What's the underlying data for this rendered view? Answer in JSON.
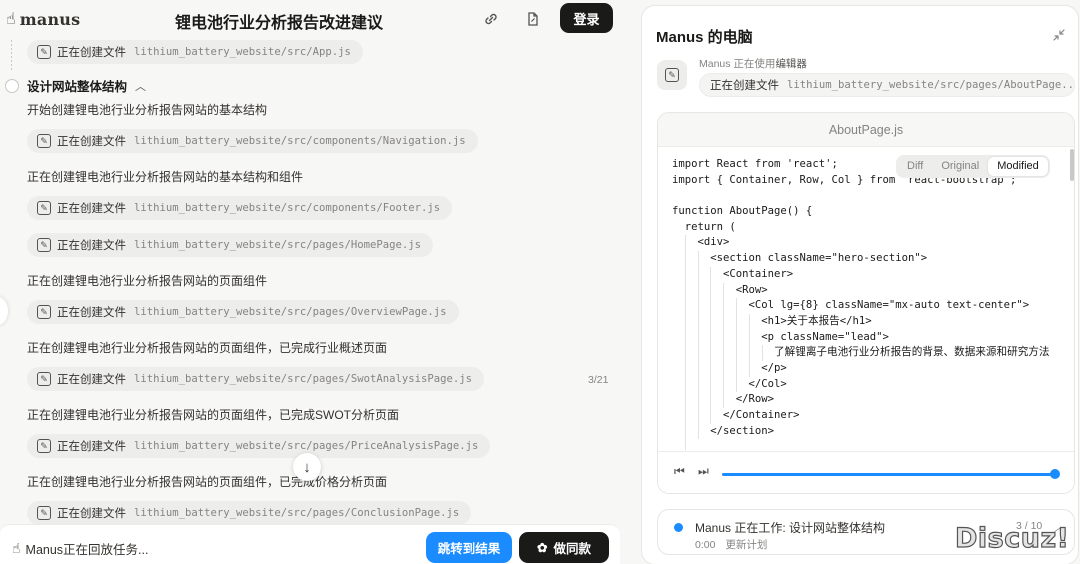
{
  "app": {
    "logo_text": "manus",
    "title": "锂电池行业分析报告改进建议",
    "login_label": "登录"
  },
  "feed": {
    "first_chip": {
      "verb": "正在创建文件",
      "path": "lithium_battery_website/src/App.js"
    },
    "section": {
      "label": "设计网站整体结构",
      "chevron": "^"
    },
    "items": [
      {
        "kind": "text",
        "text": "开始创建锂电池行业分析报告网站的基本结构"
      },
      {
        "kind": "chip",
        "verb": "正在创建文件",
        "path": "lithium_battery_website/src/components/Navigation.js"
      },
      {
        "kind": "text",
        "text": "正在创建锂电池行业分析报告网站的基本结构和组件"
      },
      {
        "kind": "chip",
        "verb": "正在创建文件",
        "path": "lithium_battery_website/src/components/Footer.js"
      },
      {
        "kind": "chip",
        "verb": "正在创建文件",
        "path": "lithium_battery_website/src/pages/HomePage.js"
      },
      {
        "kind": "text",
        "text": "正在创建锂电池行业分析报告网站的页面组件"
      },
      {
        "kind": "chip",
        "verb": "正在创建文件",
        "path": "lithium_battery_website/src/pages/OverviewPage.js"
      },
      {
        "kind": "text",
        "text": "正在创建锂电池行业分析报告网站的页面组件，已完成行业概述页面"
      },
      {
        "kind": "chip",
        "verb": "正在创建文件",
        "path": "lithium_battery_website/src/pages/SwotAnalysisPage.js"
      },
      {
        "kind": "text",
        "text": "正在创建锂电池行业分析报告网站的页面组件，已完成SWOT分析页面"
      },
      {
        "kind": "chip",
        "verb": "正在创建文件",
        "path": "lithium_battery_website/src/pages/PriceAnalysisPage.js"
      },
      {
        "kind": "text",
        "text": "正在创建锂电池行业分析报告网站的页面组件，已完成价格分析页面"
      },
      {
        "kind": "chip",
        "verb": "正在创建文件",
        "path": "lithium_battery_website/src/pages/ConclusionPage.js"
      }
    ],
    "counter": "3/21"
  },
  "bottom": {
    "replay_text": "Manus正在回放任务...",
    "jump_label": "跳转到结果",
    "same_label": "做同款"
  },
  "computer": {
    "title": "Manus 的电脑",
    "using_prefix": "Manus 正在使用",
    "using_tool": "编辑器",
    "chip": {
      "verb": "正在创建文件",
      "path": "lithium_battery_website/src/pages/AboutPage..."
    },
    "editor": {
      "filename": "AboutPage.js",
      "view_tabs": [
        "Diff",
        "Original",
        "Modified"
      ],
      "active_tab": "Modified",
      "code_lines": [
        "import React from 'react';",
        "import { Container, Row, Col } from 'react-bootstrap';",
        "",
        "function AboutPage() {",
        "  return (",
        "    <div>",
        "      <section className=\"hero-section\">",
        "        <Container>",
        "          <Row>",
        "            <Col lg={8} className=\"mx-auto text-center\">",
        "              <h1>关于本报告</h1>",
        "              <p className=\"lead\">",
        "                了解锂离子电池行业分析报告的背景、数据来源和研究方法",
        "              </p>",
        "            </Col>",
        "          </Row>",
        "        </Container>",
        "      </section>",
        "    "
      ],
      "playback_progress": 1.0
    },
    "status": {
      "text": "Manus 正在工作: 设计网站整体结构",
      "time": "0:00",
      "plan_label": "更新计划",
      "count": "3 / 10"
    }
  },
  "watermark": "Discuz!",
  "colors": {
    "accent": "#1a8cff",
    "dark": "#1a1a19"
  },
  "icons": {
    "logo": "hand-logo-icon",
    "link": "link-icon",
    "file": "file-share-icon",
    "pen": "edit-icon",
    "collapse": "collapse-icon",
    "prev": "skip-back-icon",
    "next": "skip-forward-icon",
    "down": "arrow-down-icon"
  }
}
